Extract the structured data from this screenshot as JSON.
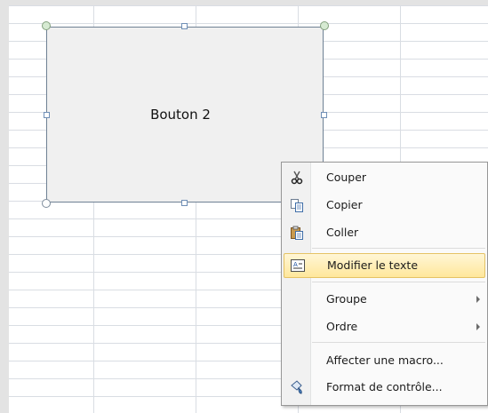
{
  "shape": {
    "label": "Bouton 2"
  },
  "menu": {
    "items": [
      {
        "label": "Couper",
        "icon": "scissors-icon"
      },
      {
        "label": "Copier",
        "icon": "copy-icon"
      },
      {
        "label": "Coller",
        "icon": "paste-icon"
      },
      {
        "label": "Modifier le texte",
        "icon": "edit-text-icon",
        "highlighted": true
      },
      {
        "label": "Groupe",
        "submenu": true
      },
      {
        "label": "Ordre",
        "submenu": true
      },
      {
        "label": "Affecter une macro..."
      },
      {
        "label": "Format de contrôle...",
        "icon": "format-control-icon"
      }
    ]
  },
  "colors": {
    "highlight": "#ffe79b",
    "gridline": "#d9dde3"
  }
}
